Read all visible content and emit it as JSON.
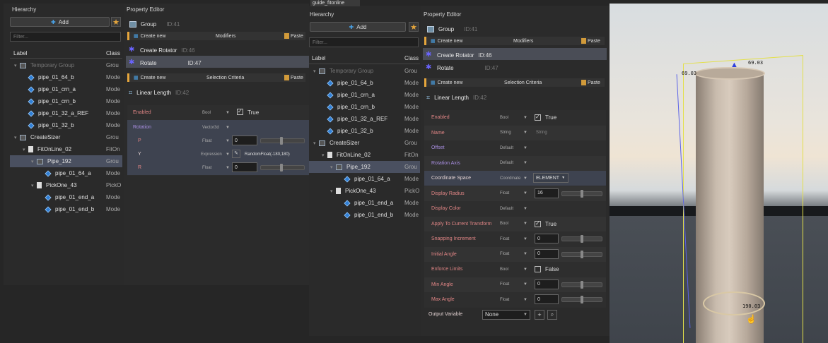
{
  "left": {
    "hierarchy_title": "Hierarchy",
    "add_label": "Add",
    "filter_placeholder": "Filter...",
    "col_label": "Label",
    "col_class": "Class",
    "rows": [
      {
        "label": "Temporary Group",
        "cls": "Grou"
      },
      {
        "label": "pipe_01_64_b",
        "cls": "Mode"
      },
      {
        "label": "pipe_01_crn_a",
        "cls": "Mode"
      },
      {
        "label": "pipe_01_crn_b",
        "cls": "Mode"
      },
      {
        "label": "pipe_01_32_a_REF",
        "cls": "Mode"
      },
      {
        "label": "pipe_01_32_b",
        "cls": "Mode"
      },
      {
        "label": "CreateSizer",
        "cls": "Grou"
      },
      {
        "label": "FitOnLine_02",
        "cls": "FitOn"
      },
      {
        "label": "Pipe_192",
        "cls": "Grou"
      },
      {
        "label": "pipe_01_64_a",
        "cls": "Mode"
      },
      {
        "label": "PickOne_43",
        "cls": "PickO"
      },
      {
        "label": "pipe_01_end_a",
        "cls": "Mode"
      },
      {
        "label": "pipe_01_end_b",
        "cls": "Mode"
      }
    ],
    "pe_title": "Property Editor",
    "group_label": "Group",
    "group_id": "ID:41",
    "create_new": "Create new",
    "modifiers": "Modifiers",
    "paste": "Paste",
    "create_rotator": "Create Rotator",
    "create_rotator_id": "ID:46",
    "rotate": "Rotate",
    "rotate_id": "ID:47",
    "selection_criteria": "Selection Criteria",
    "linear_length": "Linear Length",
    "linear_length_id": "ID:42",
    "props": {
      "enabled": "Enabled",
      "enabled_type": "Bool",
      "enabled_val": "True",
      "rotation": "Rotation",
      "rotation_type": "Vector3d",
      "p": "P",
      "p_type": "Float",
      "p_val": "0",
      "y": "Y",
      "y_type": "Expression",
      "y_val": "RandomFloat(-180,180)",
      "r": "R",
      "r_type": "Float",
      "r_val": "0"
    }
  },
  "middle": {
    "tab_label": "guide_fitonline",
    "hierarchy_title": "Hierarchy",
    "add_label": "Add",
    "filter_placeholder": "Filter...",
    "col_label": "Label",
    "col_class": "Class",
    "rows": [
      {
        "label": "Temporary Group",
        "cls": "Grou"
      },
      {
        "label": "pipe_01_64_b",
        "cls": "Mode"
      },
      {
        "label": "pipe_01_crn_a",
        "cls": "Mode"
      },
      {
        "label": "pipe_01_crn_b",
        "cls": "Mode"
      },
      {
        "label": "pipe_01_32_a_REF",
        "cls": "Mode"
      },
      {
        "label": "pipe_01_32_b",
        "cls": "Mode"
      },
      {
        "label": "CreateSizer",
        "cls": "Grou"
      },
      {
        "label": "FitOnLine_02",
        "cls": "FitOn"
      },
      {
        "label": "Pipe_192",
        "cls": "Grou"
      },
      {
        "label": "pipe_01_64_a",
        "cls": "Mode"
      },
      {
        "label": "PickOne_43",
        "cls": "PickO"
      },
      {
        "label": "pipe_01_end_a",
        "cls": "Mode"
      },
      {
        "label": "pipe_01_end_b",
        "cls": "Mode"
      }
    ]
  },
  "right": {
    "pe_title": "Property Editor",
    "group_label": "Group",
    "group_id": "ID:41",
    "create_new": "Create new",
    "modifiers": "Modifiers",
    "paste": "Paste",
    "create_rotator": "Create Rotator",
    "create_rotator_id": "ID:46",
    "rotate": "Rotate",
    "rotate_id": "ID:47",
    "selection_criteria": "Selection Criteria",
    "linear_length": "Linear Length",
    "linear_length_id": "ID:42",
    "props": [
      {
        "name": "Enabled",
        "type": "Bool",
        "ctrl": "check",
        "val": "True"
      },
      {
        "name": "Name",
        "type": "String",
        "ctrl": "text",
        "val": "String"
      },
      {
        "name": "Offset",
        "type": "Default",
        "ctrl": "none",
        "val": ""
      },
      {
        "name": "Rotation Axis",
        "type": "Default",
        "ctrl": "none",
        "val": ""
      },
      {
        "name": "Coordinate Space",
        "type": "Coordinate",
        "ctrl": "combo",
        "val": "ELEMENT"
      },
      {
        "name": "Display Radius",
        "type": "Float",
        "ctrl": "num",
        "val": "16"
      },
      {
        "name": "Display Color",
        "type": "Default",
        "ctrl": "none",
        "val": ""
      },
      {
        "name": "Apply To Current Transform",
        "type": "Bool",
        "ctrl": "check",
        "val": "True"
      },
      {
        "name": "Snapping Increment",
        "type": "Float",
        "ctrl": "num",
        "val": "0"
      },
      {
        "name": "Initial Angle",
        "type": "Float",
        "ctrl": "num",
        "val": "0"
      },
      {
        "name": "Enforce Limits",
        "type": "Bool",
        "ctrl": "checkoff",
        "val": "False"
      },
      {
        "name": "Min Angle",
        "type": "Float",
        "ctrl": "num",
        "val": "0"
      },
      {
        "name": "Max Angle",
        "type": "Float",
        "ctrl": "num",
        "val": "0"
      }
    ],
    "output_variable": "Output Variable",
    "output_value": "None"
  },
  "viewport": {
    "label_top": "69.03",
    "label_left": "69.03",
    "label_bottom": "190.03"
  }
}
